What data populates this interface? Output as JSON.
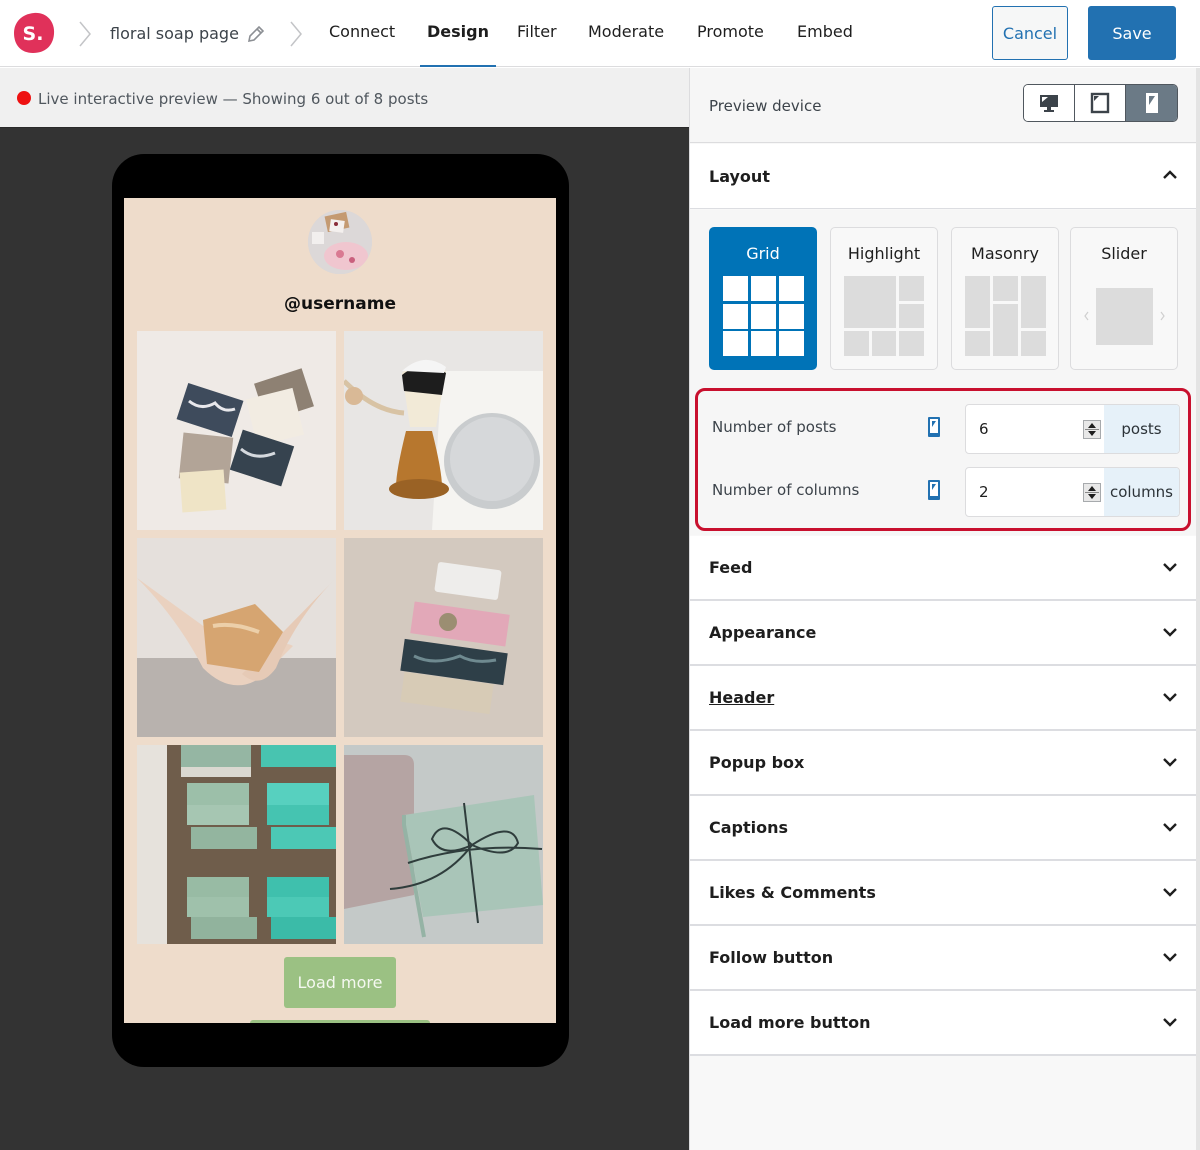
{
  "topbar": {
    "logo_text": "S.",
    "feed_name": "floral soap page",
    "tabs": [
      {
        "label": "Connect",
        "active": false
      },
      {
        "label": "Design",
        "active": true
      },
      {
        "label": "Filter",
        "active": false
      },
      {
        "label": "Moderate",
        "active": false
      },
      {
        "label": "Promote",
        "active": false
      },
      {
        "label": "Embed",
        "active": false
      }
    ],
    "cancel_label": "Cancel",
    "save_label": "Save"
  },
  "preview": {
    "status_text": "Live interactive preview — Showing 6 out of 8 posts",
    "shown_posts": 6,
    "total_posts": 8,
    "username": "@username",
    "load_more_label": "Load more",
    "posts": [
      {
        "subject": "assorted soap bars"
      },
      {
        "subject": "shaving brush and soap"
      },
      {
        "subject": "hands holding soap"
      },
      {
        "subject": "stacked soap bars"
      },
      {
        "subject": "green soap bars on tray"
      },
      {
        "subject": "soap tied with twine"
      }
    ]
  },
  "sidebar": {
    "preview_device_label": "Preview device",
    "devices": [
      {
        "name": "desktop",
        "active": false
      },
      {
        "name": "tablet",
        "active": false
      },
      {
        "name": "phone",
        "active": true
      }
    ],
    "layout": {
      "title": "Layout",
      "expanded": true,
      "options": [
        {
          "label": "Grid",
          "active": true
        },
        {
          "label": "Highlight",
          "active": false
        },
        {
          "label": "Masonry",
          "active": false
        },
        {
          "label": "Slider",
          "active": false
        }
      ],
      "number_of_posts": {
        "label": "Number of posts",
        "value": "6",
        "unit": "posts"
      },
      "number_of_columns": {
        "label": "Number of columns",
        "value": "2",
        "unit": "columns"
      }
    },
    "sections": [
      {
        "title": "Feed"
      },
      {
        "title": "Appearance"
      },
      {
        "title": "Header"
      },
      {
        "title": "Popup box"
      },
      {
        "title": "Captions"
      },
      {
        "title": "Likes & Comments"
      },
      {
        "title": "Follow button"
      },
      {
        "title": "Load more button"
      }
    ]
  },
  "colors": {
    "accent": "#2271b1",
    "layout_active": "#0073b7",
    "highlight_border": "#c8102e",
    "live_dot": "#ee1111",
    "logo": "#e0315a",
    "preview_bg": "#eedccb",
    "load_more_bg": "#9bc183"
  }
}
